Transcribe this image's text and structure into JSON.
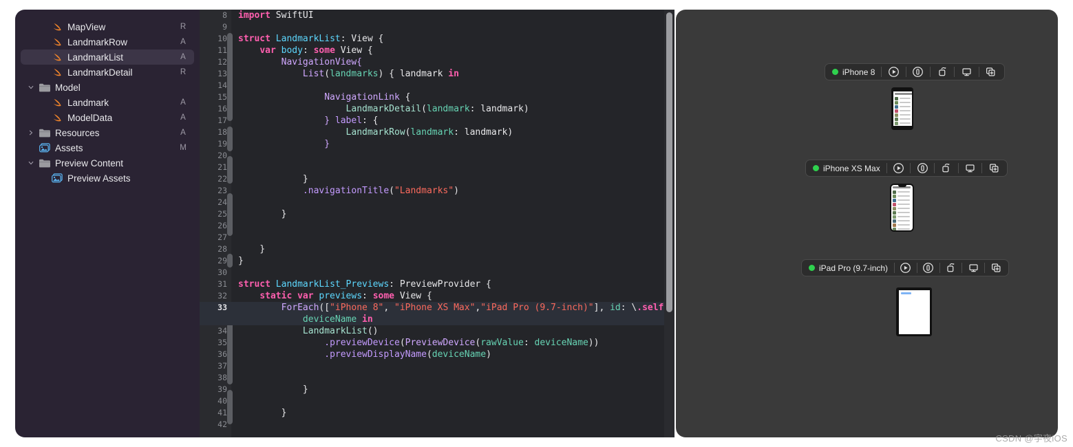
{
  "colors": {
    "sidebar_bg": "#2a2333",
    "sidebar_selected": "#3c3547",
    "editor_bg": "#242529",
    "gutter_bg": "#2a2b2f",
    "preview_bg": "#3a3a3a",
    "accent_green": "#2fd14e",
    "swift_orange": "#f0842a",
    "folder_gray": "#9b9ba0",
    "assets_blue": "#5ab3f0",
    "keyword_pink": "#ff5faf",
    "type_blue": "#5dd8ff",
    "systemtype_purple": "#d0a8ff",
    "method_purple": "#c49bff",
    "string_red": "#fc6a5d",
    "param_teal": "#67d4b4",
    "project_fn_mint": "#a6e3d0",
    "line_highlight": "#2c3039"
  },
  "sidebar": {
    "name": "project-navigator",
    "items": [
      {
        "label": "MapView",
        "status": "R",
        "icon": "swift-file-icon",
        "indent": 1,
        "disclosure": "",
        "selected": false
      },
      {
        "label": "LandmarkRow",
        "status": "A",
        "icon": "swift-file-icon",
        "indent": 1,
        "disclosure": "",
        "selected": false
      },
      {
        "label": "LandmarkList",
        "status": "A",
        "icon": "swift-file-icon",
        "indent": 1,
        "disclosure": "",
        "selected": true
      },
      {
        "label": "LandmarkDetail",
        "status": "R",
        "icon": "swift-file-icon",
        "indent": 1,
        "disclosure": "",
        "selected": false
      },
      {
        "label": "Model",
        "status": "",
        "icon": "folder-icon",
        "indent": 0,
        "disclosure": "v",
        "selected": false
      },
      {
        "label": "Landmark",
        "status": "A",
        "icon": "swift-file-icon",
        "indent": 1,
        "disclosure": "",
        "selected": false
      },
      {
        "label": "ModelData",
        "status": "A",
        "icon": "swift-file-icon",
        "indent": 1,
        "disclosure": "",
        "selected": false
      },
      {
        "label": "Resources",
        "status": "A",
        "icon": "folder-icon",
        "indent": 0,
        "disclosure": ">",
        "selected": false
      },
      {
        "label": "Assets",
        "status": "M",
        "icon": "assets-catalog-icon",
        "indent": 0,
        "disclosure": "",
        "selected": false
      },
      {
        "label": "Preview Content",
        "status": "",
        "icon": "folder-icon",
        "indent": 0,
        "disclosure": "v",
        "selected": false
      },
      {
        "label": "Preview Assets",
        "status": "",
        "icon": "assets-catalog-icon",
        "indent": 1,
        "disclosure": "",
        "selected": false
      }
    ]
  },
  "editor": {
    "name": "source-editor",
    "filename": "LandmarkList",
    "first_visible_line": 8,
    "highlighted_line": 33,
    "scrollbar": {
      "thumb_top_pct": 0.6,
      "thumb_height_pct": 70
    },
    "lines": [
      {
        "no": "8",
        "tokens": [
          {
            "t": "import ",
            "c": "kw"
          },
          {
            "t": "SwiftUI",
            "c": "pln"
          }
        ]
      },
      {
        "no": "9",
        "tokens": []
      },
      {
        "no": "10",
        "tokens": [
          {
            "t": "struct ",
            "c": "kw"
          },
          {
            "t": "LandmarkList",
            "c": "typ"
          },
          {
            "t": ": View {",
            "c": "pln"
          }
        ]
      },
      {
        "no": "11",
        "tokens": [
          {
            "t": "    ",
            "c": "pln"
          },
          {
            "t": "var ",
            "c": "kw"
          },
          {
            "t": "body",
            "c": "typ"
          },
          {
            "t": ": ",
            "c": "pln"
          },
          {
            "t": "some ",
            "c": "kw"
          },
          {
            "t": "View {",
            "c": "pln"
          }
        ]
      },
      {
        "no": "12",
        "tokens": [
          {
            "t": "        NavigationView{",
            "c": "utyp"
          }
        ]
      },
      {
        "no": "13",
        "tokens": [
          {
            "t": "            ",
            "c": "pln"
          },
          {
            "t": "List",
            "c": "utyp"
          },
          {
            "t": "(",
            "c": "pln"
          },
          {
            "t": "landmarks",
            "c": "par"
          },
          {
            "t": ") { landmark ",
            "c": "pln"
          },
          {
            "t": "in",
            "c": "kw"
          }
        ]
      },
      {
        "no": "14",
        "tokens": []
      },
      {
        "no": "15",
        "tokens": [
          {
            "t": "                ",
            "c": "pln"
          },
          {
            "t": "NavigationLink",
            "c": "utyp"
          },
          {
            "t": " {",
            "c": "pln"
          }
        ]
      },
      {
        "no": "16",
        "tokens": [
          {
            "t": "                    ",
            "c": "pln"
          },
          {
            "t": "LandmarkDetail",
            "c": "fn"
          },
          {
            "t": "(",
            "c": "pln"
          },
          {
            "t": "landmark",
            "c": "par"
          },
          {
            "t": ": landmark)",
            "c": "pln"
          }
        ]
      },
      {
        "no": "17",
        "tokens": [
          {
            "t": "                } ",
            "c": "utyp"
          },
          {
            "t": "label",
            "c": "mth"
          },
          {
            "t": ": {",
            "c": "pln"
          }
        ]
      },
      {
        "no": "18",
        "tokens": [
          {
            "t": "                    ",
            "c": "pln"
          },
          {
            "t": "LandmarkRow",
            "c": "fn"
          },
          {
            "t": "(",
            "c": "pln"
          },
          {
            "t": "landmark",
            "c": "par"
          },
          {
            "t": ": landmark)",
            "c": "pln"
          }
        ]
      },
      {
        "no": "19",
        "tokens": [
          {
            "t": "                }",
            "c": "utyp"
          }
        ]
      },
      {
        "no": "20",
        "tokens": []
      },
      {
        "no": "21",
        "tokens": []
      },
      {
        "no": "22",
        "tokens": [
          {
            "t": "            }",
            "c": "pln"
          }
        ]
      },
      {
        "no": "23",
        "tokens": [
          {
            "t": "            .",
            "c": "mth"
          },
          {
            "t": "navigationTitle",
            "c": "mth"
          },
          {
            "t": "(",
            "c": "pln"
          },
          {
            "t": "\"Landmarks\"",
            "c": "str"
          },
          {
            "t": ")",
            "c": "pln"
          }
        ]
      },
      {
        "no": "24",
        "tokens": []
      },
      {
        "no": "25",
        "tokens": [
          {
            "t": "        }",
            "c": "pln"
          }
        ]
      },
      {
        "no": "26",
        "tokens": []
      },
      {
        "no": "27",
        "tokens": []
      },
      {
        "no": "28",
        "tokens": [
          {
            "t": "    }",
            "c": "pln"
          }
        ]
      },
      {
        "no": "29",
        "tokens": [
          {
            "t": "}",
            "c": "pln"
          }
        ]
      },
      {
        "no": "30",
        "tokens": []
      },
      {
        "no": "31",
        "tokens": [
          {
            "t": "struct ",
            "c": "kw"
          },
          {
            "t": "LandmarkList_Previews",
            "c": "typ"
          },
          {
            "t": ": PreviewProvider {",
            "c": "pln"
          }
        ]
      },
      {
        "no": "32",
        "tokens": [
          {
            "t": "    ",
            "c": "pln"
          },
          {
            "t": "static var ",
            "c": "kw"
          },
          {
            "t": "previews",
            "c": "typ"
          },
          {
            "t": ": ",
            "c": "pln"
          },
          {
            "t": "some ",
            "c": "kw"
          },
          {
            "t": "View {",
            "c": "pln"
          }
        ]
      },
      {
        "no": "33",
        "highlight": true,
        "tokens": [
          {
            "t": "        ",
            "c": "pln"
          },
          {
            "t": "ForEach",
            "c": "utyp"
          },
          {
            "t": "([",
            "c": "pln"
          },
          {
            "t": "\"iPhone 8\"",
            "c": "str"
          },
          {
            "t": ", ",
            "c": "pln"
          },
          {
            "t": "\"iPhone XS Max\"",
            "c": "str"
          },
          {
            "t": ",",
            "c": "pln"
          },
          {
            "t": "\"iPad Pro (9.7-inch)\"",
            "c": "str"
          },
          {
            "t": "], ",
            "c": "pln"
          },
          {
            "t": "id",
            "c": "par"
          },
          {
            "t": ": \\",
            "c": "pln"
          },
          {
            "t": ".self",
            "c": "kw"
          },
          {
            "t": ") {",
            "c": "pln"
          }
        ]
      },
      {
        "no": "",
        "highlight": true,
        "tokens": [
          {
            "t": "            ",
            "c": "pln"
          },
          {
            "t": "deviceName",
            "c": "par"
          },
          {
            "t": " ",
            "c": "pln"
          },
          {
            "t": "in",
            "c": "kw"
          }
        ]
      },
      {
        "no": "34",
        "tokens": [
          {
            "t": "            ",
            "c": "pln"
          },
          {
            "t": "LandmarkList",
            "c": "fn"
          },
          {
            "t": "()",
            "c": "pln"
          }
        ]
      },
      {
        "no": "35",
        "tokens": [
          {
            "t": "                .",
            "c": "mth"
          },
          {
            "t": "previewDevice",
            "c": "mth"
          },
          {
            "t": "(",
            "c": "pln"
          },
          {
            "t": "PreviewDevice",
            "c": "utyp"
          },
          {
            "t": "(",
            "c": "pln"
          },
          {
            "t": "rawValue",
            "c": "par"
          },
          {
            "t": ": ",
            "c": "pln"
          },
          {
            "t": "deviceName",
            "c": "par"
          },
          {
            "t": "))",
            "c": "pln"
          }
        ]
      },
      {
        "no": "36",
        "tokens": [
          {
            "t": "                .",
            "c": "mth"
          },
          {
            "t": "previewDisplayName",
            "c": "mth"
          },
          {
            "t": "(",
            "c": "pln"
          },
          {
            "t": "deviceName",
            "c": "par"
          },
          {
            "t": ")",
            "c": "pln"
          }
        ]
      },
      {
        "no": "37",
        "tokens": []
      },
      {
        "no": "38",
        "tokens": []
      },
      {
        "no": "39",
        "tokens": [
          {
            "t": "            }",
            "c": "pln"
          }
        ]
      },
      {
        "no": "40",
        "tokens": []
      },
      {
        "no": "41",
        "tokens": [
          {
            "t": "        }",
            "c": "pln"
          }
        ]
      },
      {
        "no": "42",
        "tokens": []
      }
    ]
  },
  "preview_canvas": {
    "name": "swiftui-preview-canvas",
    "toolbar_buttons": [
      {
        "icon": "play-preview-icon",
        "title": "Live Preview"
      },
      {
        "icon": "inspect-preview-icon",
        "title": "Inspect Preview"
      },
      {
        "icon": "duplicate-shape-icon",
        "title": "Variants"
      },
      {
        "icon": "preview-on-device-icon",
        "title": "Preview on Device"
      },
      {
        "icon": "add-preview-icon",
        "title": "Duplicate Preview"
      }
    ],
    "previews": [
      {
        "device_name": "iPhone 8",
        "status": "running",
        "status_color": "#2fd14e",
        "device_type": "iphone-8",
        "content": "landmark-list"
      },
      {
        "device_name": "iPhone XS Max",
        "status": "running",
        "status_color": "#2fd14e",
        "device_type": "iphone-xs-max",
        "content": "landmark-list"
      },
      {
        "device_name": "iPad Pro (9.7-inch)",
        "status": "running",
        "status_color": "#2fd14e",
        "device_type": "ipad-pro-97",
        "content": "landmark-list-blank"
      }
    ],
    "landmark_rows": [
      {
        "color": "#4f6b4a"
      },
      {
        "color": "#6d8c5a"
      },
      {
        "color": "#3f6f8f"
      },
      {
        "color": "#c0506a"
      },
      {
        "color": "#8a8f63"
      },
      {
        "color": "#5d7a52"
      },
      {
        "color": "#7c9a6e"
      },
      {
        "color": "#4b6a76"
      },
      {
        "color": "#a0764c"
      },
      {
        "color": "#6a8660"
      },
      {
        "color": "#3d5a6b"
      },
      {
        "color": "#404040"
      }
    ]
  },
  "watermark": {
    "text": "CSDN @宇夜iOS"
  }
}
